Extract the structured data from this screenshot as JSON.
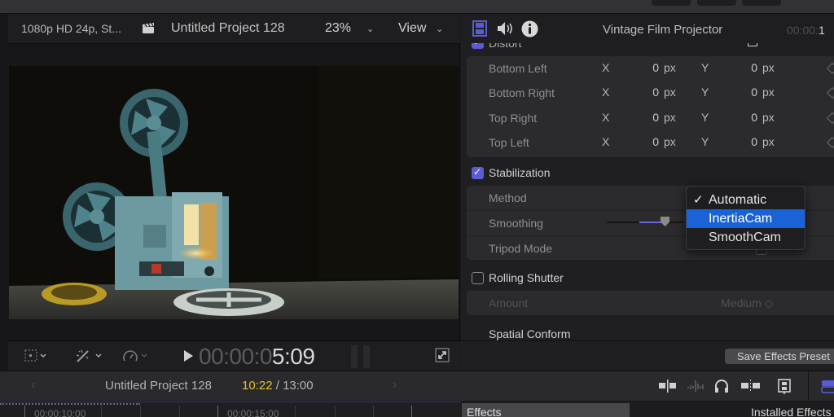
{
  "viewer": {
    "format": "1080p HD 24p, St...",
    "project_title": "Untitled Project 128",
    "zoom": "23%",
    "view_label": "View",
    "timecode_dim": "00:00:0",
    "timecode_lit": "5:09"
  },
  "inspector": {
    "tabs": [
      "video-inspector",
      "audio-inspector",
      "info-inspector"
    ],
    "active_tab": "video-inspector",
    "clip_title": "Vintage Film Projector",
    "time_dim": "00:00:",
    "time_lit": "1",
    "distort": {
      "label": "Distort",
      "enabled": true,
      "rows": [
        {
          "label": "Bottom Left",
          "x_axis": "X",
          "x": "0",
          "x_unit": "px",
          "y_axis": "Y",
          "y": "0",
          "y_unit": "px"
        },
        {
          "label": "Bottom Right",
          "x_axis": "X",
          "x": "0",
          "x_unit": "px",
          "y_axis": "Y",
          "y": "0",
          "y_unit": "px"
        },
        {
          "label": "Top Right",
          "x_axis": "X",
          "x": "0",
          "x_unit": "px",
          "y_axis": "Y",
          "y": "0",
          "y_unit": "px"
        },
        {
          "label": "Top Left",
          "x_axis": "X",
          "x": "0",
          "x_unit": "px",
          "y_axis": "Y",
          "y": "0",
          "y_unit": "px"
        }
      ]
    },
    "stabilization": {
      "label": "Stabilization",
      "enabled": true,
      "method_label": "Method",
      "smoothing_label": "Smoothing",
      "smoothing_value": 0.75,
      "tripod_label": "Tripod Mode",
      "tripod_checked": false,
      "method_menu": {
        "options": [
          "Automatic",
          "InertiaCam",
          "SmoothCam"
        ],
        "checked": "Automatic",
        "highlighted": "InertiaCam",
        "check_glyph": "✓"
      }
    },
    "rolling_shutter": {
      "label": "Rolling Shutter",
      "enabled": false,
      "amount_label": "Amount",
      "amount_value": "Medium ◇"
    },
    "spatial_conform_label": "Spatial Conform",
    "save_preset_label": "Save Effects Preset"
  },
  "timeline": {
    "prev_glyph": "‹",
    "next_glyph": "›",
    "project_title": "Untitled Project 128",
    "current_time": "10:22",
    "separator": " / ",
    "total_time": "13:00",
    "ruler_labels": [
      "00:00:10:00",
      "00:00:15:00"
    ]
  },
  "browser": {
    "effects_tab": "Effects",
    "installed_label": "Installed Effects"
  },
  "colors": {
    "accent": "#5b5bd6",
    "menu_highlight": "#1a63d6",
    "timecode_yellow": "#e2c032"
  }
}
